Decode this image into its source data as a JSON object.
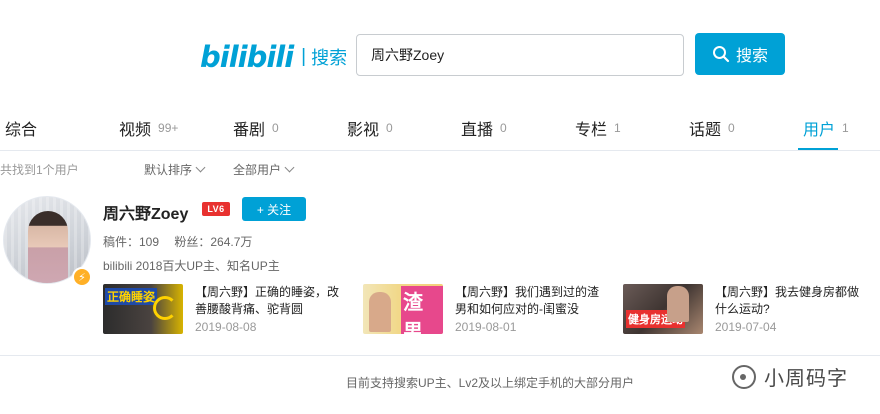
{
  "header": {
    "logo_mark": "bilibili",
    "logo_separator": "|",
    "logo_text": "搜索",
    "search_value": "周六野Zoey",
    "search_button_label": "搜索",
    "accent_color": "#00a1d6"
  },
  "tabs": [
    {
      "label": "综合",
      "count": ""
    },
    {
      "label": "视频",
      "count": "99+"
    },
    {
      "label": "番剧",
      "count": "0"
    },
    {
      "label": "影视",
      "count": "0"
    },
    {
      "label": "直播",
      "count": "0"
    },
    {
      "label": "专栏",
      "count": "1"
    },
    {
      "label": "话题",
      "count": "0"
    },
    {
      "label": "用户",
      "count": "1",
      "active": true
    }
  ],
  "filters": {
    "found_text": "共找到1个用户",
    "sort_label": "默认排序",
    "type_label": "全部用户"
  },
  "user": {
    "name": "周六野Zoey",
    "level": "LV6",
    "follow_label": "+ 关注",
    "videos_stat": "稿件：109",
    "fans_stat": "粉丝：264.7万",
    "description": "bilibili 2018百大UP主、知名UP主",
    "verified_icon": "lightning-icon"
  },
  "videos": [
    {
      "title": "【周六野】正确的睡姿，改善腰酸背痛、驼背圆",
      "date": "2019-08-08",
      "thumb_caption": "正确睡姿"
    },
    {
      "title": "【周六野】我们遇到过的渣男和如何应对的-闺蜜没",
      "date": "2019-08-01",
      "thumb_caption": "渣男"
    },
    {
      "title": "【周六野】我去健身房都做什么运动?",
      "date": "2019-07-04",
      "thumb_caption": "健身房运动"
    }
  ],
  "footer": {
    "note": "目前支持搜索UP主、Lv2及以上绑定手机的大部分用户"
  },
  "watermark": {
    "text": "小周码字"
  }
}
